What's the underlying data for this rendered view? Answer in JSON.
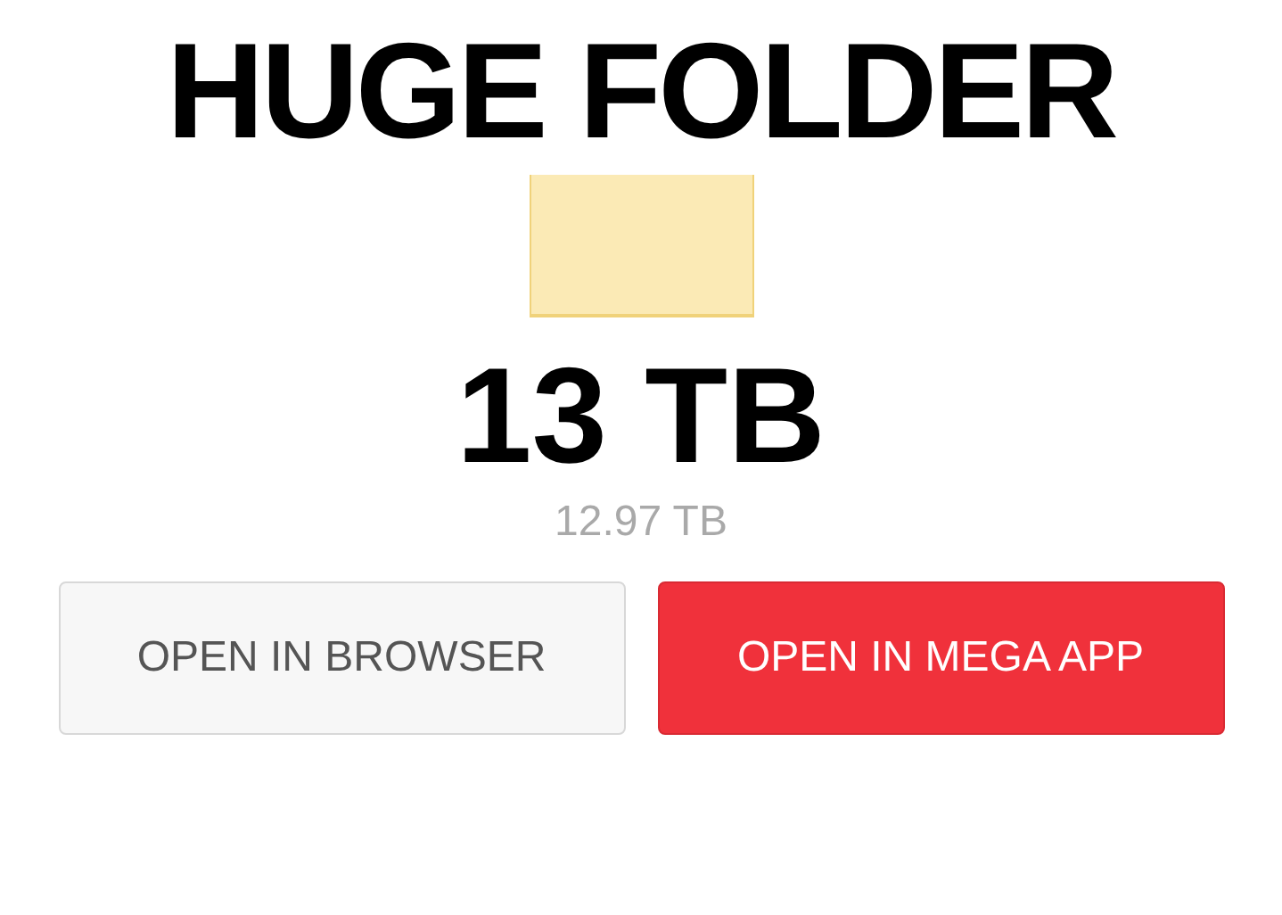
{
  "caption_top": "HUGE FOLDER",
  "caption_size": "13 TB",
  "folder_size": "12.97 TB",
  "buttons": [
    {
      "label": "OPEN IN BROWSER",
      "kind": "secondary"
    },
    {
      "label": "OPEN IN MEGA APP",
      "kind": "primary"
    }
  ]
}
